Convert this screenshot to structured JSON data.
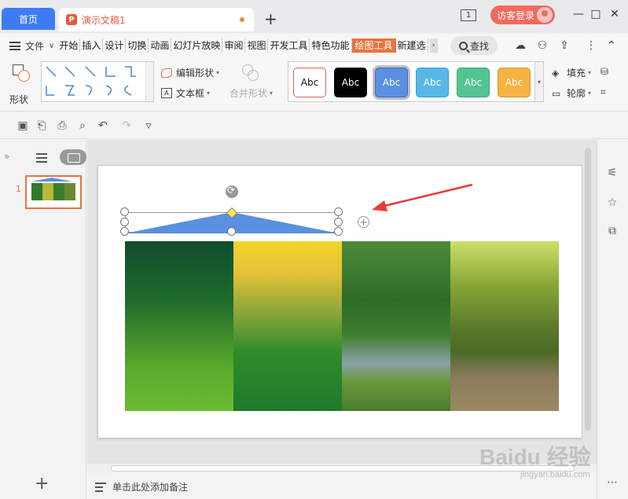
{
  "tabs": {
    "home": "首页",
    "doc_title": "演示文稿1"
  },
  "window": {
    "count": "1",
    "login": "访客登录"
  },
  "menu": {
    "file": "文件",
    "items": [
      "开始",
      "插入",
      "设计",
      "切换",
      "动画",
      "幻灯片放映",
      "审阅",
      "视图",
      "开发工具",
      "特色功能",
      "绘图工具",
      "新建选"
    ],
    "active_index": 10,
    "search": "查找"
  },
  "ribbon": {
    "shape": "形状",
    "edit_shape": "编辑形状",
    "textbox": "文本框",
    "merge_shape": "合并形状",
    "styles": [
      {
        "label": "Abc",
        "bg": "#ffffff",
        "fg": "#111111",
        "border": "#e06060"
      },
      {
        "label": "Abc",
        "bg": "#000000",
        "fg": "#ffffff",
        "border": "#000000"
      },
      {
        "label": "Abc",
        "bg": "#5b8fe0",
        "fg": "#ffffff",
        "border": "#3a6cc0"
      },
      {
        "label": "Abc",
        "bg": "#57b8e8",
        "fg": "#ffffff",
        "border": "#3a9ccc"
      },
      {
        "label": "Abc",
        "bg": "#52c492",
        "fg": "#ffffff",
        "border": "#38a878"
      },
      {
        "label": "Abc",
        "bg": "#f5b342",
        "fg": "#ffffff",
        "border": "#d8962a"
      }
    ],
    "fill": "填充",
    "outline": "轮廓"
  },
  "slides": {
    "current": "1"
  },
  "notes": {
    "placeholder": "单击此处添加备注"
  },
  "watermark": {
    "brand": "Baidu 经验",
    "url": "jingyan.baidu.com"
  },
  "colors": {
    "accent": "#e8743c",
    "home_tab": "#3d7cf5",
    "login": "#ee6b5e",
    "triangle": "#5b8fe0",
    "annotation_arrow": "#e83a3a"
  }
}
